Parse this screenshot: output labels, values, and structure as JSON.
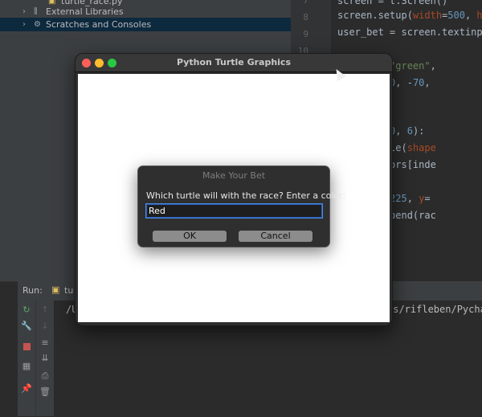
{
  "project": {
    "items": [
      {
        "label": "turtle_race.py",
        "icon": "python-file-icon"
      },
      {
        "label": "External Libraries",
        "icon": "library-icon"
      },
      {
        "label": "Scratches and Consoles",
        "icon": "scratches-icon"
      }
    ]
  },
  "editor": {
    "line_numbers": [
      "7",
      "8",
      "9",
      "10",
      "11",
      "12",
      "13",
      "14",
      "15",
      "16",
      "17",
      "18",
      "19"
    ]
  },
  "run": {
    "label": "Run:",
    "tab_label": "turtle_race",
    "output_prefix": "/U",
    "output_path": "rs/rifleben/Pycha"
  },
  "turtle_window": {
    "title": "Python Turtle Graphics",
    "dot_colors": [
      "#ff5f57",
      "#febc2e",
      "#28c840"
    ]
  },
  "dialog": {
    "title": "Make Your Bet",
    "prompt": "Which turtle will with the race? Enter a color:",
    "input_value": "Red",
    "ok_label": "OK",
    "cancel_label": "Cancel"
  }
}
